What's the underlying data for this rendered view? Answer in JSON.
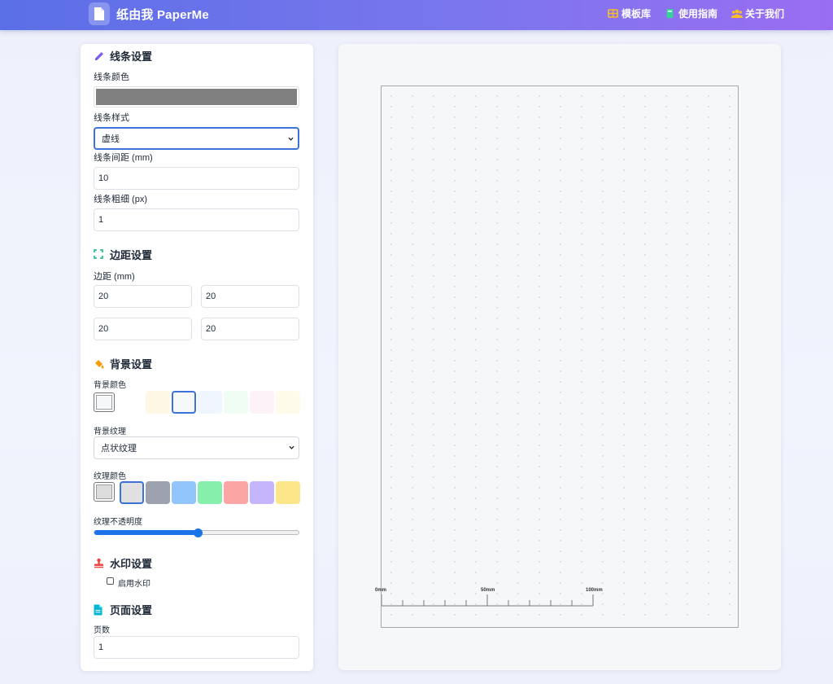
{
  "header": {
    "app_title": "纸由我 PaperMe",
    "nav": [
      {
        "label": "模板库",
        "icon": "grid-icon",
        "color": "#fbbf24"
      },
      {
        "label": "使用指南",
        "icon": "book-icon",
        "color": "#34d399"
      },
      {
        "label": "关于我们",
        "icon": "users-icon",
        "color": "#fbbf24"
      }
    ]
  },
  "line_settings": {
    "title": "线条设置",
    "color_label": "线条颜色",
    "color_value": "#808080",
    "style_label": "线条样式",
    "style_value": "虚线",
    "spacing_label": "线条间距 (mm)",
    "spacing_value": "10",
    "width_label": "线条粗细 (px)",
    "width_value": "1"
  },
  "margin_settings": {
    "title": "边距设置",
    "label": "边距 (mm)",
    "top": "20",
    "right": "20",
    "bottom": "20",
    "left": "20"
  },
  "background_settings": {
    "title": "背景设置",
    "color_label": "背景颜色",
    "custom_color": "#f6f7f9",
    "swatches": [
      "#fff7e6",
      "#f6f8fa",
      "#eff6ff",
      "#f0fdf4",
      "#fdf2f8",
      "#fffbeb"
    ],
    "selected_swatch": 1,
    "texture_label": "背景纹理",
    "texture_value": "点状纹理",
    "texture_color_label": "纹理颜色",
    "texture_custom_color": "#dddddd",
    "texture_swatches": [
      "#e0e0e0",
      "#9ca3af",
      "#93c5fd",
      "#86efac",
      "#fca5a5",
      "#c4b5fd",
      "#fde68a"
    ],
    "texture_selected": 0,
    "opacity_label": "纹理不透明度",
    "opacity_value": 0.5
  },
  "watermark_settings": {
    "title": "水印设置",
    "enable_label": "启用水印",
    "enabled": false
  },
  "page_settings": {
    "title": "页面设置",
    "count_label": "页数",
    "count_value": "1"
  },
  "preview": {
    "ruler_labels": [
      "0mm",
      "50mm",
      "100mm"
    ]
  }
}
